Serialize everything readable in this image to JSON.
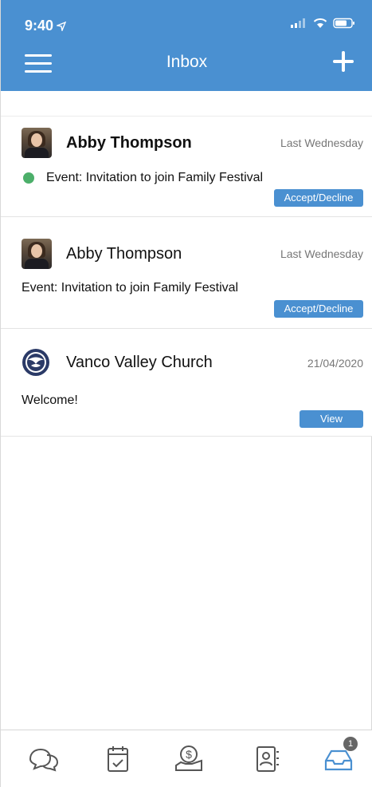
{
  "status_bar": {
    "time": "9:40"
  },
  "header": {
    "title": "Inbox"
  },
  "messages": [
    {
      "sender": "Abby Thompson",
      "date": "Last Wednesday",
      "text": "Event: Invitation to join Family Festival",
      "action": "Accept/Decline",
      "unread": true
    },
    {
      "sender": "Abby Thompson",
      "date": "Last Wednesday",
      "text": "Event: Invitation to join Family Festival",
      "action": "Accept/Decline",
      "unread": false
    },
    {
      "sender": "Vanco Valley Church",
      "date": "21/04/2020",
      "text": "Welcome!",
      "action": "View",
      "unread": false
    }
  ],
  "tabbar": {
    "tabs": [
      {
        "icon": "chat-icon"
      },
      {
        "icon": "calendar-icon"
      },
      {
        "icon": "giving-icon"
      },
      {
        "icon": "directory-icon"
      },
      {
        "icon": "inbox-icon",
        "active": true,
        "badge": "1"
      }
    ]
  },
  "colors": {
    "brand": "#4a90d1",
    "unread_dot": "#4caf6a",
    "badge": "#666666"
  }
}
